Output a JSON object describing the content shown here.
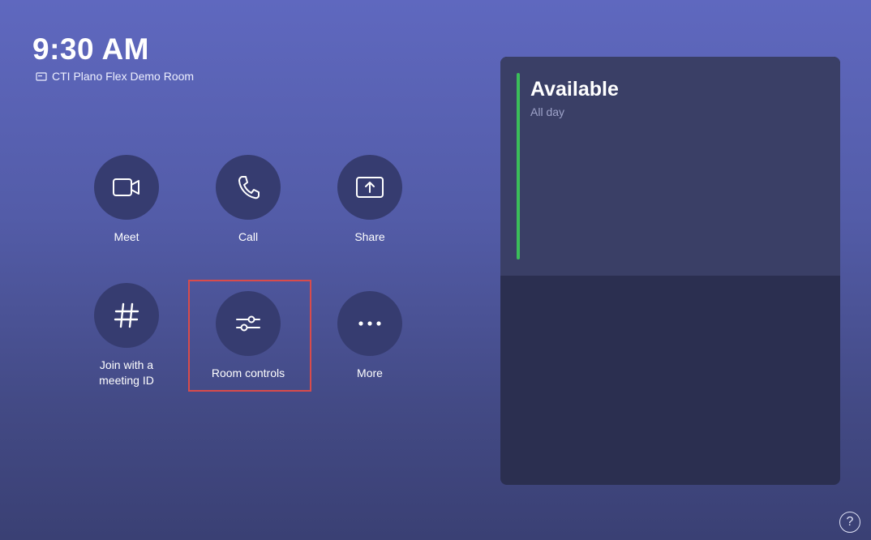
{
  "header": {
    "time": "9:30 AM",
    "room_name": "CTI Plano Flex Demo Room",
    "room_icon": "display-icon"
  },
  "actions": [
    {
      "label": "Meet",
      "icon": "video-camera-icon"
    },
    {
      "label": "Call",
      "icon": "phone-icon"
    },
    {
      "label": "Share",
      "icon": "share-screen-icon"
    },
    {
      "label": "Join with a\nmeeting ID",
      "icon": "hash-icon"
    },
    {
      "label": "Room controls",
      "icon": "sliders-icon"
    },
    {
      "label": "More",
      "icon": "more-dots-icon"
    }
  ],
  "calendar": {
    "status": "Available",
    "subtitle": "All day"
  },
  "help": {
    "glyph": "?"
  },
  "colors": {
    "accent_available": "#3bbd5a",
    "highlight_box": "#d94b4b"
  }
}
